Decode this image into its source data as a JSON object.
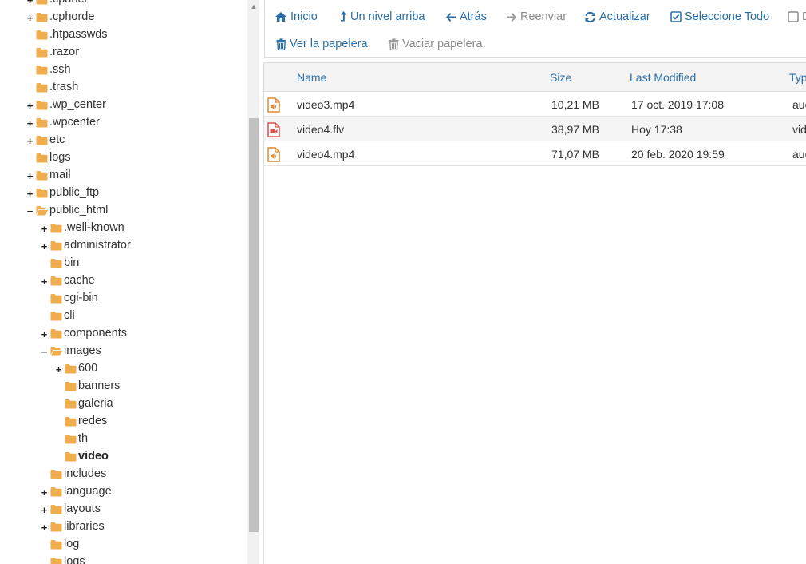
{
  "tree": {
    "items": [
      {
        "label": ".cpanel",
        "toggle": "+",
        "level": 0
      },
      {
        "label": ".cphorde",
        "toggle": "+",
        "level": 0
      },
      {
        "label": ".htpasswds",
        "toggle": "",
        "level": 0
      },
      {
        "label": ".razor",
        "toggle": "",
        "level": 0
      },
      {
        "label": ".ssh",
        "toggle": "",
        "level": 0
      },
      {
        "label": ".trash",
        "toggle": "",
        "level": 0
      },
      {
        "label": ".wp_center",
        "toggle": "+",
        "level": 0
      },
      {
        "label": ".wpcenter",
        "toggle": "+",
        "level": 0
      },
      {
        "label": "etc",
        "toggle": "+",
        "level": 0
      },
      {
        "label": "logs",
        "toggle": "",
        "level": 0
      },
      {
        "label": "mail",
        "toggle": "+",
        "level": 0
      },
      {
        "label": "public_ftp",
        "toggle": "+",
        "level": 0
      },
      {
        "label": "public_html",
        "toggle": "−",
        "level": 0,
        "open": true
      },
      {
        "label": ".well-known",
        "toggle": "+",
        "level": 1
      },
      {
        "label": "administrator",
        "toggle": "+",
        "level": 1
      },
      {
        "label": "bin",
        "toggle": "",
        "level": 1
      },
      {
        "label": "cache",
        "toggle": "+",
        "level": 1
      },
      {
        "label": "cgi-bin",
        "toggle": "",
        "level": 1
      },
      {
        "label": "cli",
        "toggle": "",
        "level": 1
      },
      {
        "label": "components",
        "toggle": "+",
        "level": 1
      },
      {
        "label": "images",
        "toggle": "−",
        "level": 1,
        "open": true
      },
      {
        "label": "600",
        "toggle": "+",
        "level": 2
      },
      {
        "label": "banners",
        "toggle": "",
        "level": 2
      },
      {
        "label": "galeria",
        "toggle": "",
        "level": 2
      },
      {
        "label": "redes",
        "toggle": "",
        "level": 2
      },
      {
        "label": "th",
        "toggle": "",
        "level": 2
      },
      {
        "label": "video",
        "toggle": "",
        "level": 2,
        "selected": true
      },
      {
        "label": "includes",
        "toggle": "",
        "level": 1
      },
      {
        "label": "language",
        "toggle": "+",
        "level": 1
      },
      {
        "label": "layouts",
        "toggle": "+",
        "level": 1
      },
      {
        "label": "libraries",
        "toggle": "+",
        "level": 1
      },
      {
        "label": "log",
        "toggle": "",
        "level": 1
      },
      {
        "label": "logs",
        "toggle": "",
        "level": 1
      }
    ]
  },
  "toolbar": {
    "home": "Inicio",
    "up": "Un nivel arriba",
    "back": "Atrás",
    "forward": "Reenviar",
    "reload": "Actualizar",
    "select_all": "Seleccione Todo",
    "unselect_all": "D",
    "view_trash": "Ver la papelera",
    "empty_trash": "Vaciar papelera"
  },
  "table": {
    "columns": {
      "name": "Name",
      "size": "Size",
      "modified": "Last Modified",
      "type": "Typ"
    },
    "rows": [
      {
        "name": "video3.mp4",
        "size": "10,21 MB",
        "modified": "17 oct. 2019 17:08",
        "type": "auc",
        "icon": "audio-file-icon"
      },
      {
        "name": "video4.flv",
        "size": "38,97 MB",
        "modified": "Hoy 17:38",
        "type": "vid",
        "icon": "video-file-icon"
      },
      {
        "name": "video4.mp4",
        "size": "71,07 MB",
        "modified": "20 feb. 2020 19:59",
        "type": "auc",
        "icon": "audio-file-icon"
      }
    ]
  },
  "colors": {
    "link": "#2a6ea8",
    "folder": "#f0ad4e",
    "audio_icon": "#e08a2c",
    "video_icon": "#d9534f"
  }
}
